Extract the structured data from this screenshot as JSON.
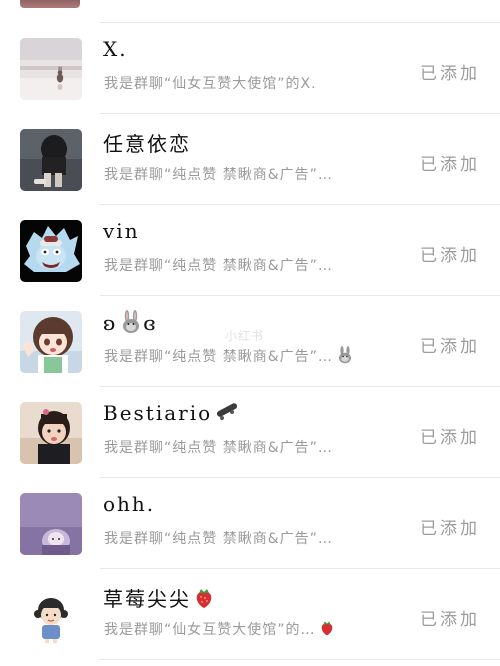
{
  "status_label": "已添加",
  "watermark": "小红书",
  "contacts": [
    {
      "name": "X.",
      "subtitle": "我是群聊“仙女互赞大使馆”的X.",
      "avatar": "snow-rabbit-avatar"
    },
    {
      "name": "任意依恋",
      "subtitle": "我是群聊“纯点赞 禁瞅商&广告”…",
      "avatar": "dark-figure-avatar"
    },
    {
      "name": "vin",
      "subtitle": "我是群聊“纯点赞 禁瞅商&广告”…",
      "avatar": "anime-white-hair-avatar"
    },
    {
      "name": "ʚ",
      "name_suffix": "ɞ",
      "name_emoji": "rabbit-icon",
      "subtitle": "我是群聊“纯点赞 禁瞅商&广告”…",
      "subtitle_emoji": "rabbit-icon",
      "avatar": "anime-girl-avatar"
    },
    {
      "name": "Bestiario",
      "name_emoji": "skateboard-icon",
      "subtitle": "我是群聊“纯点赞 禁瞅商&广告”…",
      "avatar": "child-photo-avatar"
    },
    {
      "name": "ohh.",
      "subtitle": "我是群聊“纯点赞 禁瞅商&广告”…",
      "avatar": "purple-anime-avatar"
    },
    {
      "name": "草莓尖尖",
      "name_emoji": "strawberry-icon",
      "subtitle": "我是群聊“仙女互赞大使馆”的…",
      "subtitle_emoji": "strawberry-icon",
      "avatar": "cartoon-girl-avatar"
    }
  ]
}
